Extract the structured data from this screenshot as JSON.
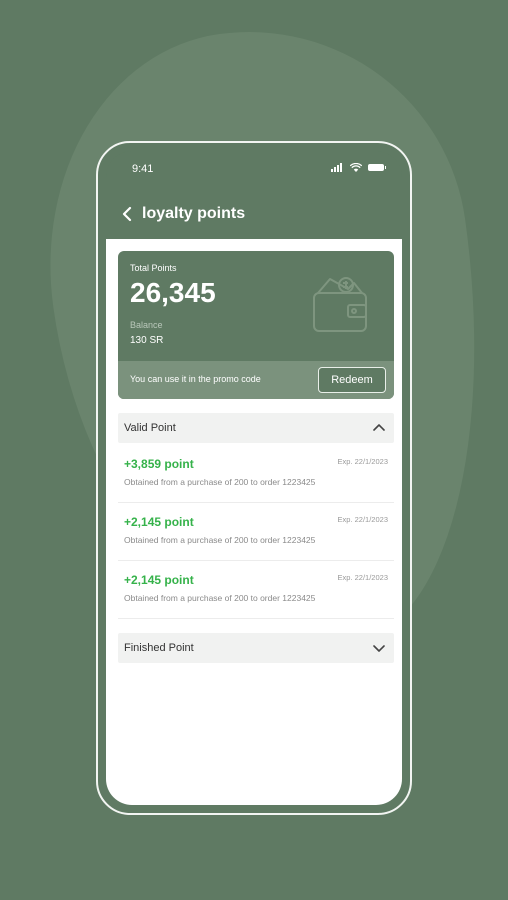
{
  "status_bar": {
    "time": "9:41"
  },
  "header": {
    "title": "loyalty points"
  },
  "summary": {
    "total_label": "Total Points",
    "total_value": "26,345",
    "balance_label": "Balance",
    "balance_value": "130 SR",
    "promo_text": "You can use it in the promo code",
    "redeem_label": "Redeem"
  },
  "valid_section": {
    "title": "Valid Point",
    "items": [
      {
        "points": "+3,859 point",
        "expiry": "Exp. 22/1/2023",
        "description": "Obtained from a purchase of 200 to order 1223425"
      },
      {
        "points": "+2,145 point",
        "expiry": "Exp. 22/1/2023",
        "description": "Obtained from a purchase of 200 to order 1223425"
      },
      {
        "points": "+2,145 point",
        "expiry": "Exp. 22/1/2023",
        "description": "Obtained from a purchase of 200 to order 1223425"
      }
    ]
  },
  "finished_section": {
    "title": "Finished Point"
  },
  "colors": {
    "brand": "#5f7a63",
    "points_green": "#35b24a"
  }
}
